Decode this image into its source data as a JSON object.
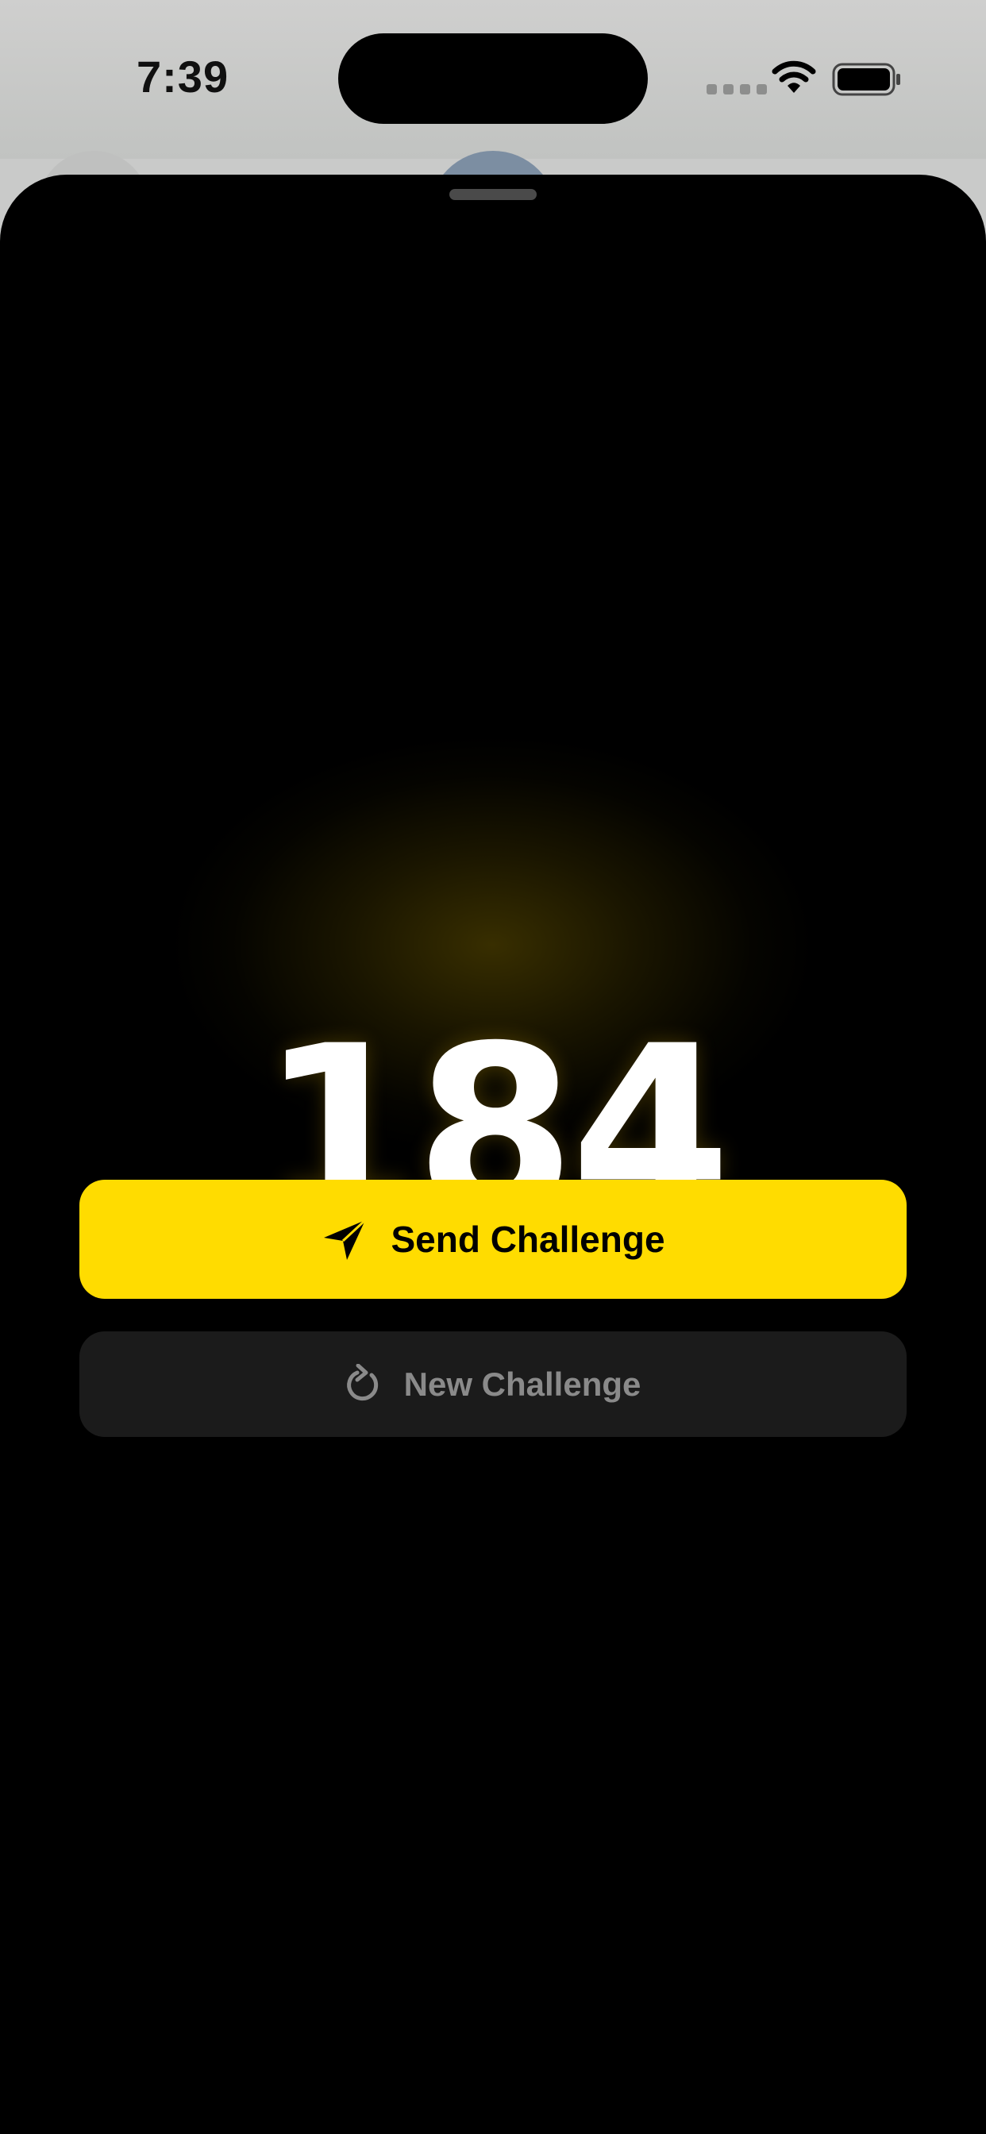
{
  "status_bar": {
    "time": "7:39"
  },
  "challenge": {
    "number": "184"
  },
  "actions": {
    "send_label": "Send Challenge",
    "new_label": "New Challenge"
  },
  "icons": {
    "send": "paper-plane-icon",
    "refresh": "refresh-icon",
    "wifi": "wifi-icon",
    "battery": "battery-icon"
  },
  "colors": {
    "accent": "#ffdc00",
    "sheet_background": "#000000",
    "secondary_button": "#1b1b1b",
    "secondary_text": "#8a8a8a"
  }
}
